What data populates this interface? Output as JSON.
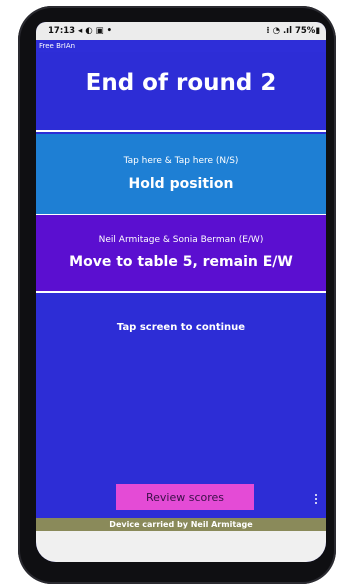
{
  "status_bar": {
    "time_and_icons": "17:13 ◂ ◐ ▣ •",
    "right_status": "⁝ ◔ .ıl 75%▮"
  },
  "app_bar": {
    "title": "Free BrIAn"
  },
  "round": {
    "title": "End of round 2"
  },
  "ns_panel": {
    "pair": "Tap here & Tap here (N/S)",
    "instruction": "Hold position"
  },
  "ew_panel": {
    "pair": "Neil Armitage & Sonia Berman (E/W)",
    "instruction": "Move to table 5, remain E/W"
  },
  "main": {
    "tap_to_continue": "Tap screen to continue"
  },
  "buttons": {
    "review_scores": "Review scores"
  },
  "footer": {
    "device_carried_by": "Device carried by Neil Armitage"
  },
  "colors": {
    "background": "#2d2dd6",
    "ns_panel": "#1e7fd4",
    "ew_panel": "#5b0fd0",
    "review_button": "#e44bd6",
    "footer": "#8a8a5a"
  },
  "icons": [
    "more-vert-icon"
  ]
}
